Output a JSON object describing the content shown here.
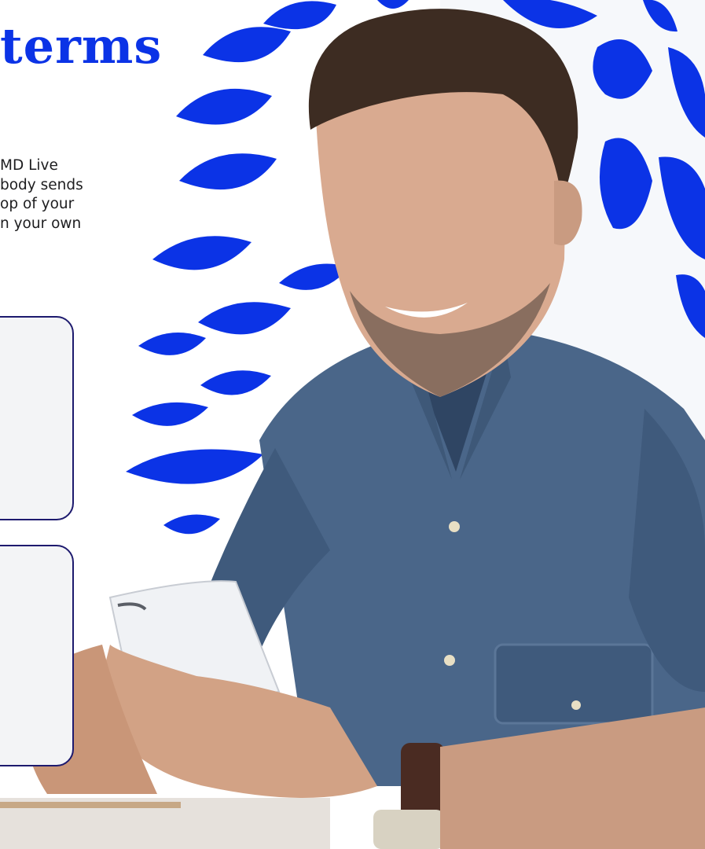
{
  "colors": {
    "brand_blue": "#0b33e6",
    "card_border": "#1d1a6e",
    "card_fill": "#f3f4f6",
    "text_dark": "#1d1d1f"
  },
  "page": {
    "heading": "terms",
    "intro_lines": [
      "MD Live",
      "body sends",
      "op of your",
      "n your own"
    ]
  }
}
